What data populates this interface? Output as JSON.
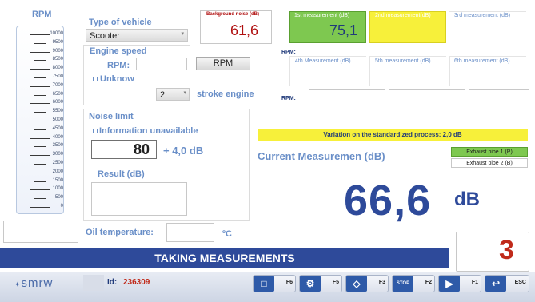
{
  "rpm": {
    "title": "RPM",
    "scale": [
      "10000",
      "9500",
      "9000",
      "8500",
      "8000",
      "7500",
      "7000",
      "6500",
      "6000",
      "5500",
      "5000",
      "4500",
      "4000",
      "3500",
      "3000",
      "2500",
      "2000",
      "1500",
      "1000",
      "500",
      "0"
    ]
  },
  "vehicle": {
    "type_label": "Type of vehicle",
    "type_value": "Scooter",
    "engine_speed_label": "Engine speed",
    "rpm_label": "RPM:",
    "rpm_value": "",
    "rpm_button": "RPM",
    "unknow_label": "Unknow",
    "stroke_value": "2",
    "stroke_label": "stroke engine"
  },
  "noise_limit": {
    "title": "Noise limit",
    "info_unavailable": "Information unavailable",
    "value": "80",
    "tolerance": "+ 4,0 dB",
    "result_label": "Result (dB)"
  },
  "measurements": {
    "background_label": "Background noise (dB)",
    "background_value": "61,6",
    "rpm_label_1": "RPM:",
    "rpm_label_2": "RPM:",
    "items": [
      {
        "label": "1st measurement (dB)",
        "value": "75,1"
      },
      {
        "label": "2nd measurement(dB)",
        "value": ""
      },
      {
        "label": "3rd measurement (dB)",
        "value": ""
      },
      {
        "label": "4th Measurement (dB)",
        "value": ""
      },
      {
        "label": "5th measurement (dB)",
        "value": ""
      },
      {
        "label": "6th measurement (dB)",
        "value": ""
      }
    ]
  },
  "variation": "Variation on the standardized process: 2,0 dB",
  "current": {
    "label": "Current Measuremen (dB)",
    "value": "66,6",
    "unit": "dB"
  },
  "exhaust": {
    "pipe1": "Exhaust pipe 1 (P)",
    "pipe2": "Exhaust pipe 2 (B)"
  },
  "oil": {
    "label": "Oil temperature:",
    "unit": "ºC"
  },
  "status": "TAKING MEASUREMENTS",
  "counter": "3",
  "footer": {
    "logo": "smrw",
    "id_label": "Id:",
    "id_value": "236309",
    "keys": [
      "F6",
      "F5",
      "F3",
      "F2",
      "F1",
      "ESC"
    ],
    "stop_text": "STOP"
  },
  "colors": {
    "accent_blue": "#2e4a9a",
    "value_blue": "#2e4a9a",
    "green_active": "#7ec850",
    "yellow": "#f7f03a",
    "red": "#c02a1a"
  }
}
